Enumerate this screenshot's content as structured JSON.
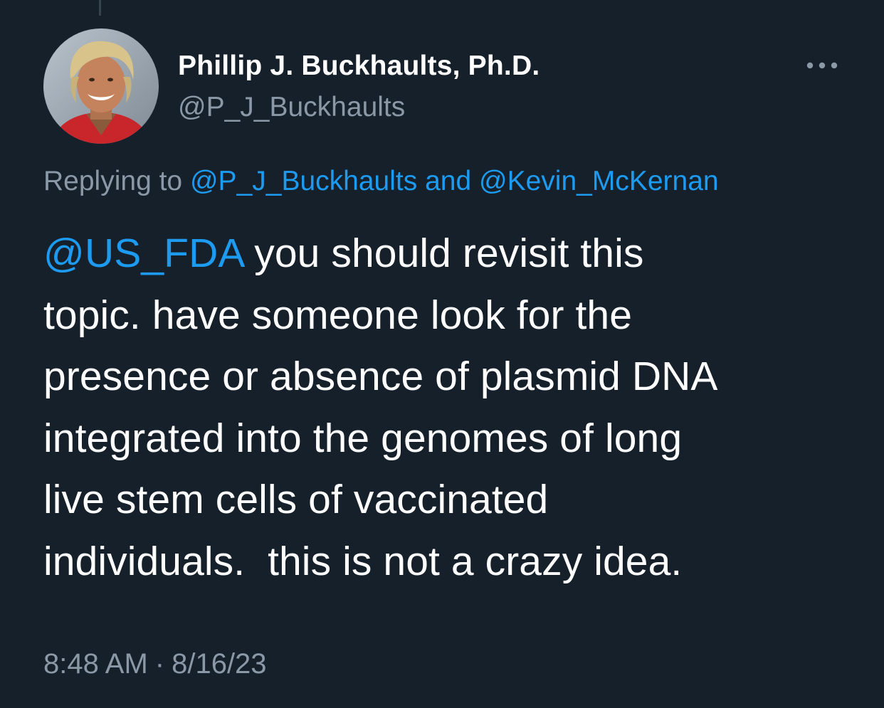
{
  "author": {
    "display_name": "Phillip J. Buckhaults, Ph.D.",
    "handle": "@P_J_Buckhaults"
  },
  "more_icon": "more-horizontal-icon",
  "reply_context": {
    "prefix": "Replying to",
    "mention_1": "@P_J_Buckhaults",
    "conjunction": "and",
    "mention_2": "@Kevin_McKernan"
  },
  "tweet": {
    "mention": "@US_FDA",
    "line_1_rest": "you should revisit this",
    "line_2": "topic. have someone look for the",
    "line_3": "presence or absence of plasmid DNA",
    "line_4": "integrated into the genomes of long",
    "line_5": "live stem cells of vaccinated",
    "line_6": "individuals.  this is not a crazy idea."
  },
  "meta": {
    "time": "8:48 AM",
    "separator": "·",
    "date": "8/16/23"
  },
  "colors": {
    "background": "#15202b",
    "text": "#ffffff",
    "secondary_text": "#8b98a5",
    "link": "#1d9bf0"
  }
}
